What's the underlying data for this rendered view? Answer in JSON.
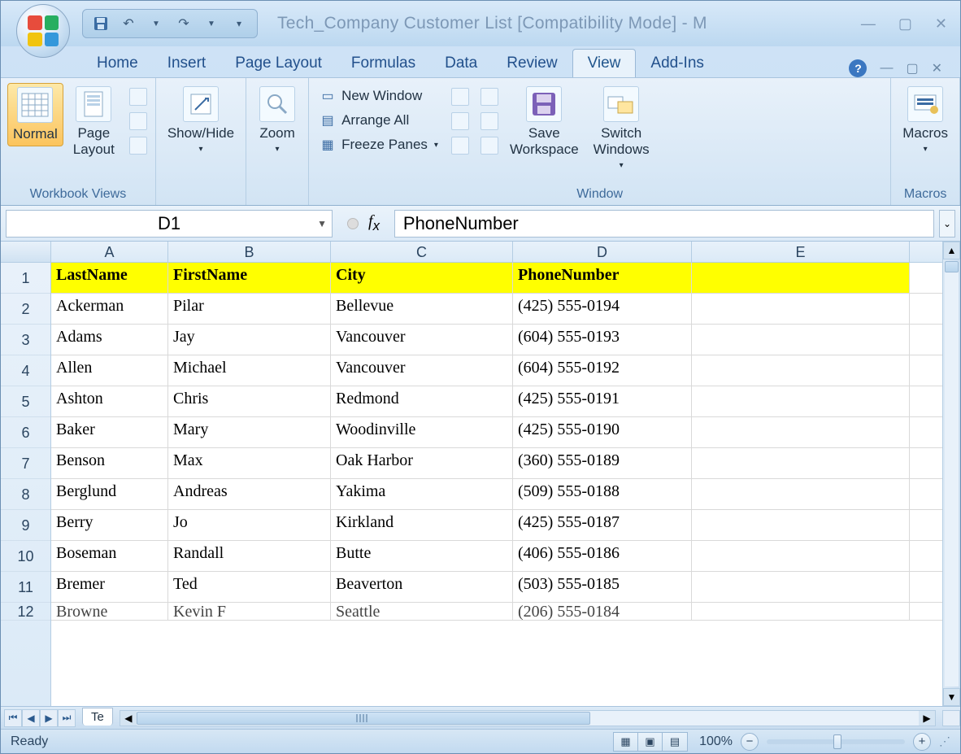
{
  "title": "Tech_Company Customer List  [Compatibility Mode] - M",
  "tabs": [
    "Home",
    "Insert",
    "Page Layout",
    "Formulas",
    "Data",
    "Review",
    "View",
    "Add-Ins"
  ],
  "activeTab": "View",
  "ribbon": {
    "group1": {
      "label": "Workbook Views",
      "normal": "Normal",
      "pageLayout": "Page\nLayout"
    },
    "group2": {
      "showHide": "Show/Hide"
    },
    "group3": {
      "zoom": "Zoom"
    },
    "group4": {
      "label": "Window",
      "newWindow": "New Window",
      "arrangeAll": "Arrange All",
      "freezePanes": "Freeze Panes",
      "saveWorkspace": "Save\nWorkspace",
      "switchWindows": "Switch\nWindows"
    },
    "group5": {
      "label": "Macros",
      "macros": "Macros"
    }
  },
  "nameBox": "D1",
  "formula": "PhoneNumber",
  "columns": [
    "A",
    "B",
    "C",
    "D",
    "E"
  ],
  "headers": [
    "LastName",
    "FirstName",
    "City",
    "PhoneNumber"
  ],
  "rows": [
    [
      "Ackerman",
      "Pilar",
      "Bellevue",
      "(425) 555-0194"
    ],
    [
      "Adams",
      "Jay",
      "Vancouver",
      "(604) 555-0193"
    ],
    [
      "Allen",
      "Michael",
      "Vancouver",
      "(604) 555-0192"
    ],
    [
      "Ashton",
      "Chris",
      "Redmond",
      "(425) 555-0191"
    ],
    [
      "Baker",
      "Mary",
      "Woodinville",
      "(425) 555-0190"
    ],
    [
      "Benson",
      "Max",
      "Oak Harbor",
      "(360) 555-0189"
    ],
    [
      "Berglund",
      "Andreas",
      "Yakima",
      "(509) 555-0188"
    ],
    [
      "Berry",
      "Jo",
      "Kirkland",
      "(425) 555-0187"
    ],
    [
      "Boseman",
      "Randall",
      "Butte",
      "(406) 555-0186"
    ],
    [
      "Bremer",
      "Ted",
      "Beaverton",
      "(503) 555-0185"
    ]
  ],
  "partialRow": [
    "Browne",
    "Kevin F",
    "Seattle",
    "(206) 555-0184"
  ],
  "rowNumbers": [
    "1",
    "2",
    "3",
    "4",
    "5",
    "6",
    "7",
    "8",
    "9",
    "10",
    "11",
    "12"
  ],
  "sheetTab": "Te",
  "status": "Ready",
  "zoom": "100%"
}
